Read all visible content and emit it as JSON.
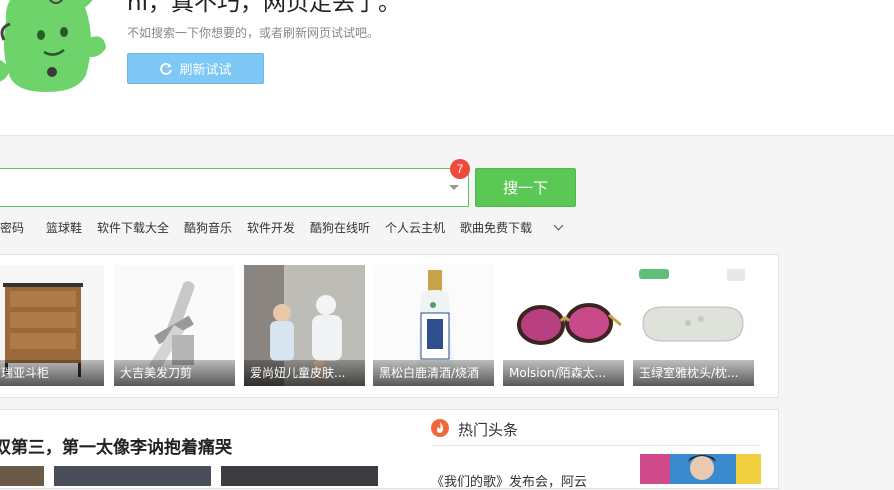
{
  "error": {
    "title": "hi，真不巧，网页走丢了。",
    "subtitle": "不如搜索一下你想要的，或者刷新网页试试吧。",
    "refresh_label": "刷新试试"
  },
  "search": {
    "badge_count": "7",
    "button_label": "搜一下"
  },
  "hotwords": [
    "注密码",
    "篮球鞋",
    "软件下载大全",
    "酷狗音乐",
    "软件开发",
    "酷狗在线听",
    "个人云主机",
    "歌曲免费下载"
  ],
  "products": [
    {
      "caption": "艾瑞亚斗柜"
    },
    {
      "caption": "大吉美发刀剪"
    },
    {
      "caption": "爱尚妞儿童皮肤..."
    },
    {
      "caption": "黑松白鹿清酒/烧酒"
    },
    {
      "caption": "Molsion/陌森太..."
    },
    {
      "caption": "玉绿室雅枕头/枕..."
    }
  ],
  "news": {
    "headline": "双第三，第一太像李讷抱着痛哭"
  },
  "hot": {
    "title": "热门头条",
    "item": "《我们的歌》发布会，阿云"
  },
  "colors": {
    "accent_green": "#5bc755",
    "refresh_blue": "#7fc8f6",
    "badge_red": "#f04a3a",
    "fire_orange": "#f2673a"
  }
}
